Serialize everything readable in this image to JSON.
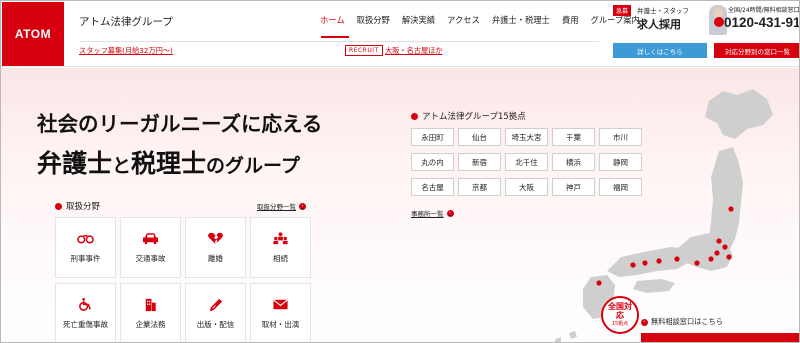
{
  "header": {
    "logo": "ATOM",
    "brand": "アトム法律グループ",
    "nav": [
      "ホーム",
      "取扱分野",
      "解決実績",
      "アクセス",
      "弁護士・税理士",
      "費用",
      "グループ案内"
    ],
    "sub_link": "スタッフ募集(月給32万円〜)",
    "recruit_badge": "RECRUIT",
    "recruit_link": "大阪・名古屋ほか",
    "hire": {
      "badge": "急募",
      "small": "弁護士・スタッフ",
      "big": "求人採用",
      "button": "詳しくはこちら"
    },
    "phone": {
      "small": "全国/24時間/無料相談窓口",
      "number": "0120-431-91",
      "button": "対応分野別の窓口一覧"
    }
  },
  "hero": {
    "line1": "社会のリーガルニーズに応える",
    "line2_a": "弁護士",
    "line2_b": "と",
    "line2_c": "税理士",
    "line2_d": "のグループ"
  },
  "services": {
    "title": "取扱分野",
    "more": "取扱分野一覧",
    "items": [
      {
        "label": "刑事事件",
        "icon": "handcuffs-icon"
      },
      {
        "label": "交通事故",
        "icon": "car-icon"
      },
      {
        "label": "離婚",
        "icon": "broken-heart-icon"
      },
      {
        "label": "相続",
        "icon": "family-icon"
      },
      {
        "label": "死亡重傷事故",
        "icon": "wheelchair-icon"
      },
      {
        "label": "企業法務",
        "icon": "building-icon"
      },
      {
        "label": "出版・配信",
        "icon": "pen-icon"
      },
      {
        "label": "取材・出演",
        "icon": "mail-icon"
      }
    ]
  },
  "offices": {
    "title": "アトム法律グループ15拠点",
    "more": "事務所一覧",
    "items": [
      "永田町",
      "仙台",
      "埼玉大宮",
      "千葉",
      "市川",
      "丸の内",
      "新宿",
      "北千住",
      "横浜",
      "静岡",
      "名古屋",
      "京都",
      "大阪",
      "神戸",
      "福岡"
    ]
  },
  "seal": {
    "main": "全国対応",
    "sub": "15拠点"
  },
  "consult_link": "無料相談窓口はこちら",
  "colors": {
    "brand_red": "#d7000f",
    "hire_blue": "#3c9bd6",
    "map_gray": "#cfcfcf"
  }
}
